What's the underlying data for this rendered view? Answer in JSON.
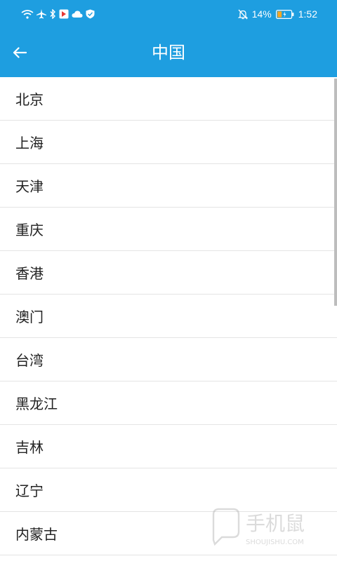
{
  "status_bar": {
    "battery_percent": "14%",
    "time": "1:52",
    "left_icons": [
      "wifi-icon",
      "airplane-icon",
      "bluetooth-icon",
      "app-badge-icon",
      "cloud-icon",
      "shield-icon"
    ],
    "right_icons": [
      "notifications-off-icon",
      "battery-icon"
    ]
  },
  "header": {
    "title": "中国",
    "back_icon": "arrow-left-icon"
  },
  "regions": [
    {
      "label": "北京"
    },
    {
      "label": "上海"
    },
    {
      "label": "天津"
    },
    {
      "label": "重庆"
    },
    {
      "label": "香港"
    },
    {
      "label": "澳门"
    },
    {
      "label": "台湾"
    },
    {
      "label": "黑龙江"
    },
    {
      "label": "吉林"
    },
    {
      "label": "辽宁"
    },
    {
      "label": "内蒙古"
    }
  ],
  "watermark": {
    "text": "手机鼠",
    "subtext": "SHOUJISHU.COM"
  },
  "colors": {
    "primary": "#1e9ee0",
    "text": "#222222",
    "divider": "#e4e4e4"
  }
}
